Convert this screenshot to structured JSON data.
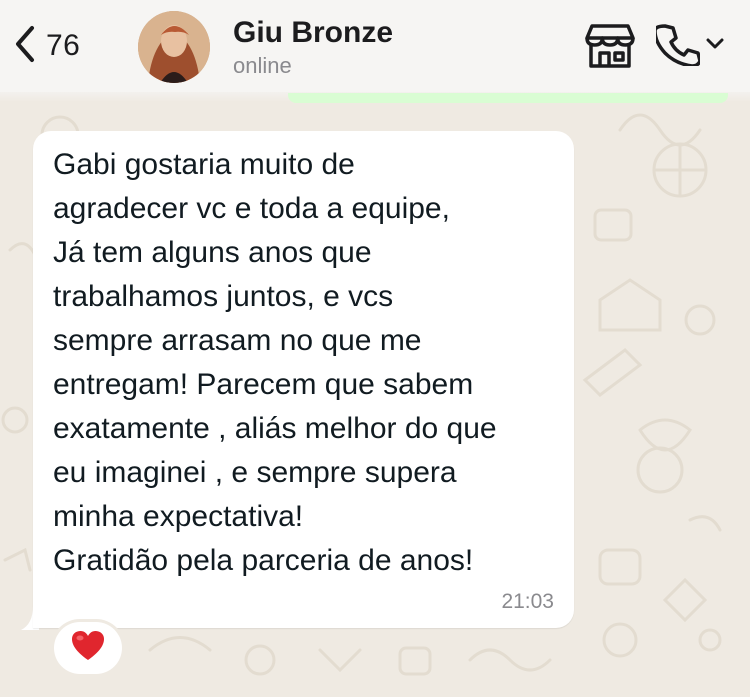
{
  "header": {
    "back_count": "76",
    "contact_name": "Giu Bronze",
    "status": "online"
  },
  "message": {
    "lines": [
      "Gabi gostaria muito de",
      "agradecer vc e toda a equipe,",
      "Já tem alguns anos que",
      "trabalhamos juntos, e vcs",
      "sempre arrasam no que me",
      "entregam! Parecem que sabem",
      "exatamente , aliás melhor do que",
      "eu imaginei , e sempre supera",
      "minha expectativa!",
      "Gratidão pela parceria de anos!"
    ],
    "time": "21:03",
    "reaction": "❤️"
  },
  "icons": {
    "back": "chevron-left-icon",
    "store": "storefront-icon",
    "call": "phone-icon",
    "dropdown": "chevron-down-icon"
  },
  "colors": {
    "background": "#efeae2",
    "bubble": "#ffffff",
    "outgoing_strip": "#d9fdd3",
    "header": "#f6f5f3"
  }
}
